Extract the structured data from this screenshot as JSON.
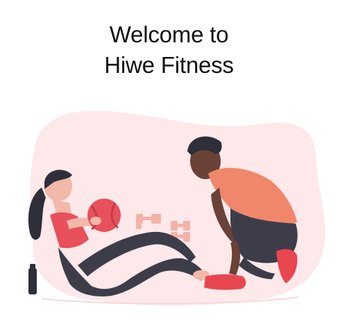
{
  "welcome": {
    "line1": "Welcome to",
    "line2": "Hiwe Fitness"
  },
  "illustration": {
    "subject": "two people exercising: woman doing sit-ups with medicine ball, man coaching while kneeling",
    "colors": {
      "blob": "#fde8ea",
      "ball": "#e8505b",
      "woman_top": "#e8505b",
      "man_shirt": "#f0876a",
      "shoes": "#e8474f",
      "pants": "#3d3d4a",
      "dumbbells": "#f4b3a8",
      "bottle": "#2f2f3a"
    }
  }
}
